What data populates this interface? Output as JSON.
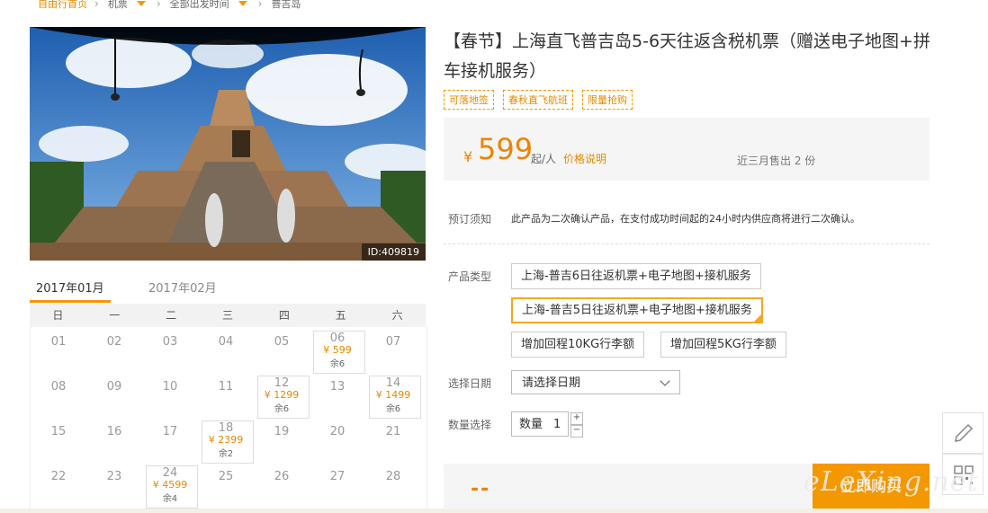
{
  "breadcrumb": [
    "自由行首页",
    "机票",
    "全部出发时间",
    "普吉岛"
  ],
  "photo_id": "ID:409819",
  "calendar": {
    "months": [
      "2017年01月",
      "2017年02月"
    ],
    "weekdays": [
      "日",
      "一",
      "二",
      "三",
      "四",
      "五",
      "六"
    ],
    "weeks": [
      [
        {
          "d": "01"
        },
        {
          "d": "02"
        },
        {
          "d": "03"
        },
        {
          "d": "04"
        },
        {
          "d": "05"
        },
        {
          "d": "06",
          "p": "¥ 599",
          "r": "余6"
        },
        {
          "d": "07"
        }
      ],
      [
        {
          "d": "08"
        },
        {
          "d": "09"
        },
        {
          "d": "10"
        },
        {
          "d": "11"
        },
        {
          "d": "12",
          "p": "¥ 1299",
          "r": "余6"
        },
        {
          "d": "13"
        },
        {
          "d": "14",
          "p": "¥ 1499",
          "r": "余6"
        }
      ],
      [
        {
          "d": "15"
        },
        {
          "d": "16"
        },
        {
          "d": "17"
        },
        {
          "d": "18",
          "p": "¥ 2399",
          "r": "余2"
        },
        {
          "d": "19"
        },
        {
          "d": "20"
        },
        {
          "d": "21"
        }
      ],
      [
        {
          "d": "22"
        },
        {
          "d": "23"
        },
        {
          "d": "24",
          "p": "¥ 4599",
          "r": "余4"
        },
        {
          "d": "25"
        },
        {
          "d": "26"
        },
        {
          "d": "27"
        },
        {
          "d": "28"
        }
      ]
    ]
  },
  "product": {
    "title": "【春节】上海直飞普吉岛5-6天往返含税机票（赠送电子地图+拼车接机服务）",
    "tags": [
      "可落地签",
      "春秋直飞航班",
      "限量抢购"
    ],
    "currency": "¥",
    "price": "599",
    "per": "起/人",
    "price_note": "价格说明",
    "sold": "近三月售出 2 份",
    "notice_label": "预订须知",
    "notice_text": "此产品为二次确认产品，在支付成功时间起的24小时内供应商将进行二次确认。",
    "type_label": "产品类型",
    "types": [
      "上海-普吉6日往返机票+电子地图+接机服务",
      "上海-普吉5日往返机票+电子地图+接机服务"
    ],
    "addons": [
      "增加回程10KG行李额",
      "增加回程5KG行李额"
    ],
    "date_label": "选择日期",
    "date_placeholder": "请选择日期",
    "qty_label": "数量选择",
    "qty_text": "数量",
    "qty_value": "1",
    "qty_plus": "+",
    "qty_minus": "−",
    "total": "--",
    "buy": "立即购买"
  },
  "watermark": "eLeXing.net",
  "colors": {
    "accent": "#f39800",
    "price": "#f08300"
  }
}
